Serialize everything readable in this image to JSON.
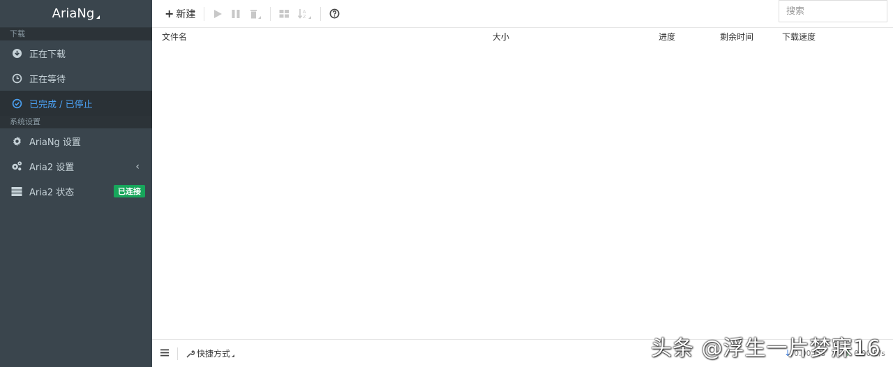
{
  "sidebar": {
    "brand": "AriaNg",
    "sections": {
      "downloads": "下载",
      "settings": "系统设置"
    },
    "items": {
      "downloading": "正在下载",
      "waiting": "正在等待",
      "stopped": "已完成 / 已停止",
      "ariang_settings": "AriaNg 设置",
      "aria2_settings": "Aria2 设置",
      "aria2_status": "Aria2 状态",
      "aria2_status_badge": "已连接"
    },
    "colors": {
      "background": "#3a454d",
      "active_text": "#4a9ff0",
      "badge": "#17a65b"
    }
  },
  "toolbar": {
    "new_label": "新建",
    "icons": [
      "plus-icon",
      "play-icon",
      "pause-icon",
      "trash-icon",
      "grid-icon",
      "sort-icon",
      "help-icon"
    ]
  },
  "search": {
    "placeholder": "搜索"
  },
  "table": {
    "columns": [
      "文件名",
      "大小",
      "进度",
      "剩余时间",
      "下载速度"
    ],
    "rows": []
  },
  "footer": {
    "shortcut_label": "快捷方式",
    "download_speed": "0.00 B/s",
    "upload_speed": "0.00 B/s"
  },
  "watermark": "头条 @浮生一片梦寐16"
}
